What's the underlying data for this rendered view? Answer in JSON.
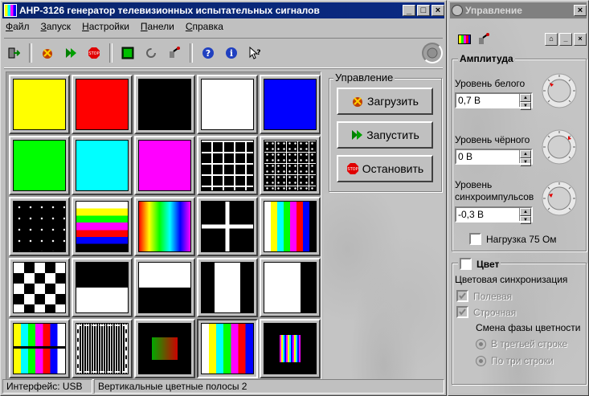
{
  "main_window": {
    "title": "АНР-3126 генератор телевизионных испытательных сигналов",
    "controls": [
      "_",
      "□",
      "×"
    ]
  },
  "menu": [
    "Файл",
    "Запуск",
    "Настройки",
    "Панели",
    "Справка"
  ],
  "toolbar": {
    "buttons": [
      "exit-icon",
      "load-icon",
      "run-icon",
      "stop-icon",
      "panel-icon",
      "refresh-icon",
      "tool-icon",
      "help-icon",
      "info-icon",
      "whats-this-icon"
    ]
  },
  "patterns": [
    "yellow",
    "red",
    "black",
    "white",
    "blue",
    "green",
    "cyan",
    "magenta",
    "grid",
    "dot-grid",
    "dots",
    "horizontal-color-bars",
    "rainbow",
    "cross",
    "vertical-color-bars",
    "checkerboard",
    "half-black-top",
    "half-black-bottom",
    "half-white-center",
    "white-window",
    "composite-test",
    "multiburst",
    "gradient-square",
    "vertical-color-bars-2",
    "fine-bars"
  ],
  "control_group": {
    "label": "Управление",
    "load": "Загрузить",
    "run": "Запустить",
    "stop": "Остановить"
  },
  "status": {
    "interface": "Интерфейс: USB",
    "pattern": "Вертикальные цветные полосы 2"
  },
  "ctrl_window": {
    "title": "Управление",
    "close": "×",
    "amplitude": {
      "label": "Амплитуда",
      "white_label": "Уровень белого",
      "white_value": "0,7 В",
      "black_label": "Уровень чёрного",
      "black_value": "0 В",
      "sync_label_1": "Уровень",
      "sync_label_2": "синхроимпульсов",
      "sync_value": "-0,3 В",
      "load_label": "Нагрузка 75 Ом"
    },
    "color": {
      "label": "Цвет",
      "sync_label": "Цветовая синхронизация",
      "field": "Полевая",
      "line": "Строчная",
      "phase_label": "Смена фазы цветности",
      "third_line": "В третьей строке",
      "three_lines": "По три строки"
    }
  },
  "colors": {
    "title_active": "#0a246a",
    "title_inactive": "#808080",
    "face": "#c0c0c0"
  }
}
